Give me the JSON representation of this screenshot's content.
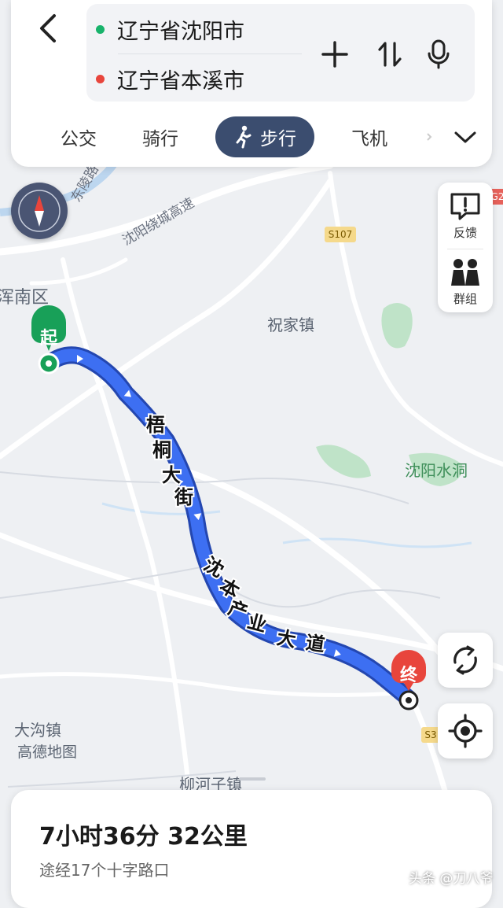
{
  "header": {
    "origin": "辽宁省沈阳市",
    "destination": "辽宁省本溪市",
    "modes": [
      "公交",
      "骑行",
      "步行",
      "飞机"
    ],
    "active_mode": "步行"
  },
  "map": {
    "start_marker": "起",
    "end_marker": "终",
    "place_labels": [
      "浑南区",
      "祝家镇",
      "沈阳水洞",
      "大沟镇",
      "柳河子镇"
    ],
    "road_labels": [
      "沈阳绕城高速",
      "东陵路"
    ],
    "highway_badges": [
      "S107",
      "S3",
      "G2"
    ],
    "route_labels": [
      "梧",
      "桐",
      "大",
      "街",
      "沈",
      "本",
      "产",
      "业",
      "大",
      "道"
    ],
    "attribution": "高德地图"
  },
  "side_panel": {
    "feedback_label": "反馈",
    "group_label": "群组"
  },
  "route": {
    "summary": "7小时36分  32公里",
    "detail": "途经17个十字路口"
  },
  "watermark": "头条 @刀八爷",
  "colors": {
    "route": "#3d6ff2",
    "route_edge": "#2447b0",
    "start_green": "#18a058",
    "end_red": "#e8453c",
    "active_tab": "#3b4d6f"
  }
}
